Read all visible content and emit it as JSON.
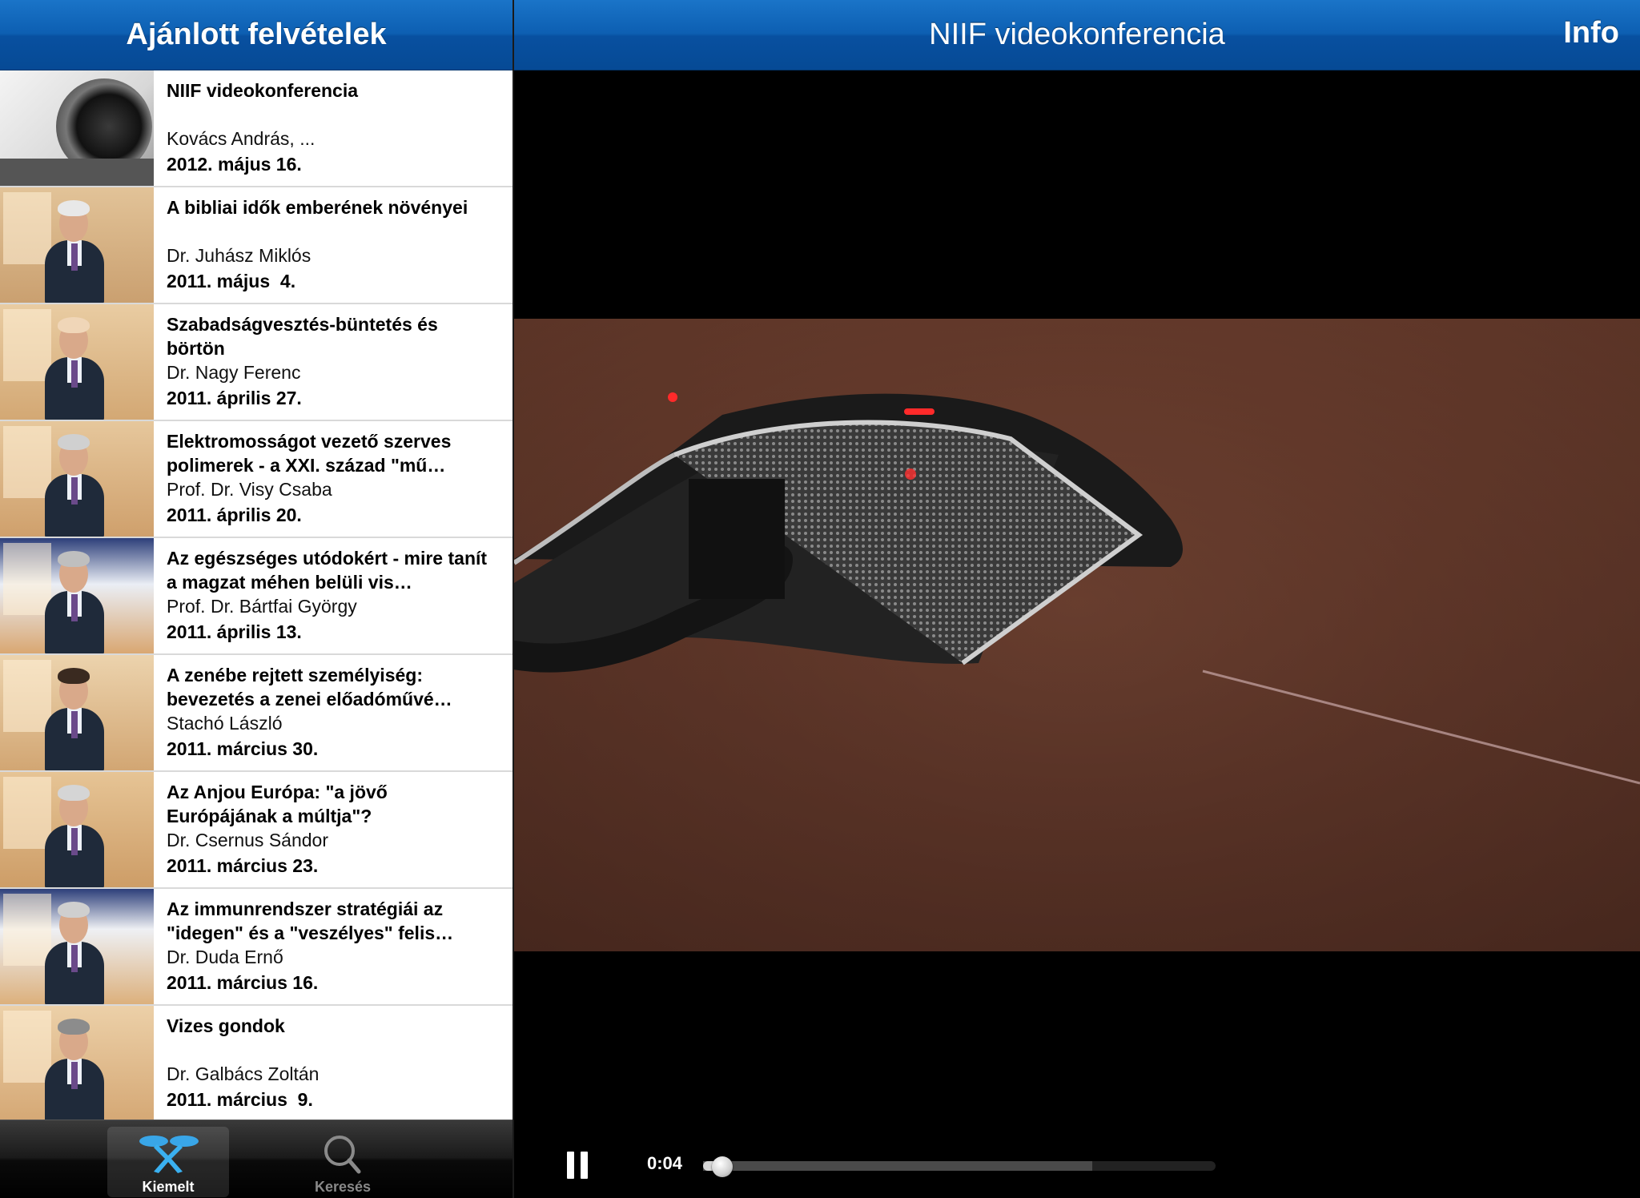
{
  "left_nav": {
    "title": "Ajánlott felvételek"
  },
  "videos": [
    {
      "title": "NIIF videokonferencia",
      "author": "Kovács András, ...",
      "date": "2012. május 16."
    },
    {
      "title": "A bibliai idők emberének növényei",
      "author": "Dr. Juhász Miklós",
      "date": "2011. május  4."
    },
    {
      "title": "Szabadságvesztés-büntetés és börtön",
      "author": "Dr. Nagy Ferenc",
      "date": "2011. április 27."
    },
    {
      "title": "Elektromosságot vezető szerves polimerek - a XXI. század \"mű…",
      "author": "Prof. Dr. Visy Csaba",
      "date": "2011. április 20."
    },
    {
      "title": "Az egészséges utódokért - mire tanít a magzat méhen belüli vis…",
      "author": "Prof. Dr. Bártfai György",
      "date": "2011. április 13."
    },
    {
      "title": "A zenébe rejtett személyiség: bevezetés a zenei előadóművé…",
      "author": "Stachó László",
      "date": "2011. március 30."
    },
    {
      "title": "Az Anjou Európa: \"a jövő Európájának a múltja\"?",
      "author": "Dr. Csernus Sándor",
      "date": "2011. március 23."
    },
    {
      "title": "Az immunrendszer stratégiái az \"idegen\" és a \"veszélyes\" felis…",
      "author": "Dr. Duda Ernő",
      "date": "2011. március 16."
    },
    {
      "title": "Vizes gondok",
      "author": "Dr. Galbács Zoltán",
      "date": "2011. március  9."
    }
  ],
  "tabs": [
    {
      "label": "Kiemelt",
      "icon": "featured-icon",
      "active": true
    },
    {
      "label": "Keresés",
      "icon": "search-icon",
      "active": false
    }
  ],
  "player": {
    "title": "NIIF videokonferencia",
    "info_label": "Info",
    "elapsed": "0:04",
    "progress_fraction": 0.02,
    "buffered_fraction": 0.76
  },
  "colors": {
    "nav_blue": "#0d5fb2",
    "row_divider": "#d9d9d9",
    "video_bg": "#000000"
  }
}
